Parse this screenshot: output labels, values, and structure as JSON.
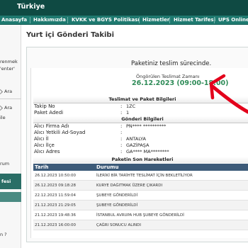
{
  "brand": {
    "name": "Türkiye"
  },
  "nav": {
    "items": [
      "Anasayfa",
      "Hakkımızda",
      "KVKK ve BGYS Politikası",
      "Hizmetler",
      "Hizmet Tarifesi",
      "UPS Online"
    ]
  },
  "sidebar": {
    "fragments": [
      "renmek",
      "'enter'",
      "Ara",
      "Ara",
      "ile",
      "rum",
      "fesi",
      "n ?"
    ]
  },
  "page": {
    "title": "Yurt içi Gönderi Takibi"
  },
  "status": {
    "title": "Paketiniz teslim sürecinde.",
    "estimate_label": "Öngörülen Teslimat Zamanı",
    "estimate_value": "26.12.2023 (09:00-18:00)"
  },
  "sections": {
    "shipment_info": "Teslimat ve Paket Bilgileri",
    "receiver_info": "Gönderi Bilgileri",
    "movements": "Paketin Son Hareketleri"
  },
  "shipment": [
    {
      "label": "Takip No",
      "value": "1ZC"
    },
    {
      "label": "Paket Adedi",
      "value": "1"
    }
  ],
  "receiver": [
    {
      "label": "Alıcı Firma Adı",
      "value": "PN**** **********"
    },
    {
      "label": "Alıcı Yetkili Ad-Soyad",
      "value": ""
    },
    {
      "label": "Alıcı İl",
      "value": "ANTALYA"
    },
    {
      "label": "Alıcı İlçe",
      "value": "GAZİPAŞA"
    },
    {
      "label": "Alıcı Adres",
      "value": "GA**** MA********"
    }
  ],
  "colon": ":",
  "table": {
    "headers": {
      "date": "Tarih",
      "status": "Durumu"
    },
    "rows": [
      {
        "date": "26.12.2023 10:50:00",
        "status": "İLERİKİ BİR TARİHTE TESLİMAT İÇİN BEKLETİLİYOR"
      },
      {
        "date": "26.12.2023 09:18:28",
        "status": "KURYE DAĞITMAK ÜZERE ÇIKARDI"
      },
      {
        "date": "22.12.2023 11:59:04",
        "status": "ŞUBEYE GÖNDERİLDİ"
      },
      {
        "date": "21.12.2023 21:29:05",
        "status": "ŞUBEYE GÖNDERİLDİ"
      },
      {
        "date": "21.12.2023 19:48:36",
        "status": "İSTANBUL AVRUPA HUB ŞUBEYE GÖNDERİLDİ"
      },
      {
        "date": "21.12.2023 16:00:00",
        "status": "ÇAĞRI SONUCU ALINDI"
      }
    ]
  },
  "colors": {
    "brand_dark": "#0f4a43",
    "nav_green": "#1f7a70",
    "estimate_green": "#2e8b57",
    "table_header": "#3c5a78",
    "annotation_red": "#e3001b"
  }
}
